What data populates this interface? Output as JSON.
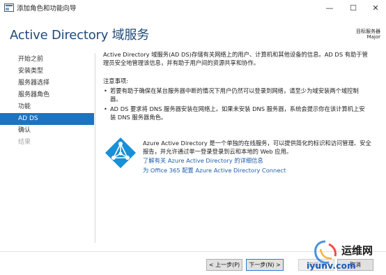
{
  "window": {
    "title": "添加角色和功能向导",
    "min_glyph": "—",
    "max_glyph": "☐",
    "close_glyph": "✕"
  },
  "header": {
    "title": "Active Directory 域服务",
    "dest_label": "目标服务器",
    "dest_value": "Major"
  },
  "nav": {
    "items": [
      {
        "label": "开始之前",
        "state": "normal"
      },
      {
        "label": "安装类型",
        "state": "normal"
      },
      {
        "label": "服务器选择",
        "state": "normal"
      },
      {
        "label": "服务器角色",
        "state": "normal"
      },
      {
        "label": "功能",
        "state": "normal"
      },
      {
        "label": "AD DS",
        "state": "active"
      },
      {
        "label": "确认",
        "state": "normal"
      },
      {
        "label": "结果",
        "state": "disabled"
      }
    ]
  },
  "content": {
    "intro_line1": "Active Directory 域服务(AD DS)存储有关网络上的用户、计算机和其他设备的信息。AD DS 有助于管",
    "intro_line2": "理员安全地管理该信息，并有助于用户间的资源共享和协作。",
    "notes_title": "注意事项:",
    "bullet1_line1": "若要有助于确保在某台服务器中断的情况下用户仍然可以登录到网络，请至少为域安装两个域控制",
    "bullet1_line2": "器。",
    "bullet2_line1": "AD DS 要求将 DNS 服务器安装在网络上。如果未安装 DNS 服务器，系统会提示你在该计算机上安",
    "bullet2_line2": "装 DNS 服务器角色。"
  },
  "azure": {
    "icon": "azure-ad-pyramid-icon",
    "line1": "Azure Active Directory 是一个单独的在线服务，可以提供简化的标识和访问管理、安全",
    "line2": "报告，并允许通过单一登录登录到云和本地的 Web 应用。",
    "link1": "了解有关 Azure Active Directory 的详细信息",
    "link2": "为 Office 365 配置 Azure Active Directory Connect"
  },
  "footer": {
    "prev": "< 上一步(P)",
    "next": "下一步(N) >",
    "install": "安装(I)",
    "cancel": "取消"
  },
  "watermark": {
    "logo_text": "运维网",
    "url": "iyunv.com"
  },
  "colors": {
    "accent": "#1e73be",
    "title": "#1e4a7a",
    "link": "#1e5fae",
    "azure": "#1890d6"
  }
}
